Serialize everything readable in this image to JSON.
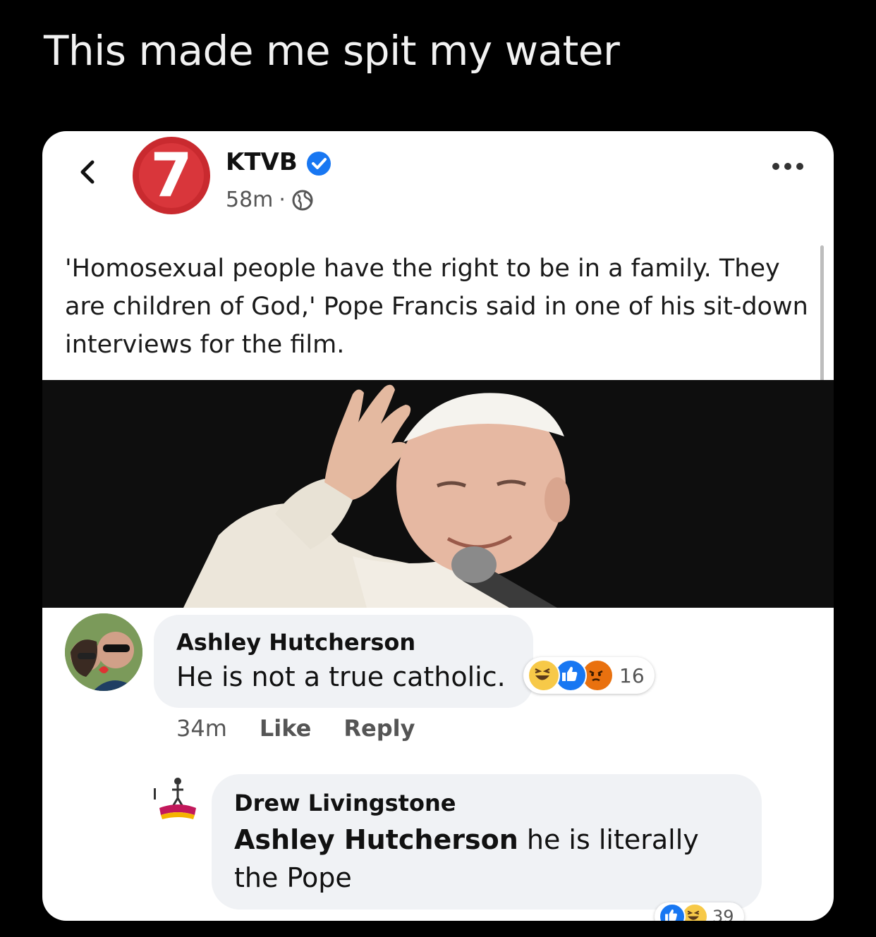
{
  "caption": "This made me spit my water",
  "colors": {
    "brand_red": "#d9363b",
    "verified_blue": "#1877f2",
    "bubble_gray": "#f0f2f5"
  },
  "post": {
    "page_name": "KTVB",
    "logo_text": "7",
    "time": "58m",
    "separator": "·",
    "audience_icon": "globe-icon",
    "text": "'Homosexual people have the right to be in a family. They are children of God,' Pope Francis said in one of his sit-down interviews for the film."
  },
  "comments": [
    {
      "author": "Ashley Hutcherson",
      "text": "He is not a true catholic.",
      "reaction_icons": [
        "haha-icon",
        "like-icon",
        "angry-icon"
      ],
      "reaction_count": "16",
      "time": "34m",
      "like_label": "Like",
      "reply_label": "Reply"
    },
    {
      "author": "Drew Livingstone",
      "mention": "Ashley Hutcherson",
      "text": " he is literally the Pope",
      "reaction_icons": [
        "like-icon",
        "haha-icon"
      ],
      "reaction_count": "39"
    }
  ]
}
